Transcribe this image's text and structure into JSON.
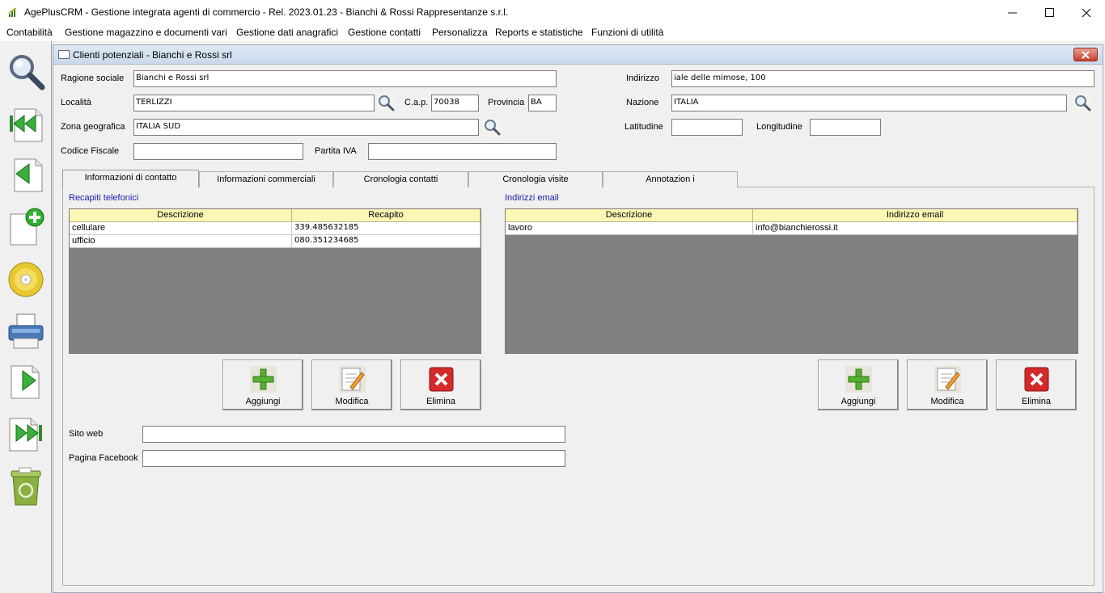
{
  "window": {
    "title": "AgePlusCRM - Gestione integrata agenti di commercio - Rel. 2023.01.23 - Bianchi & Rossi Rappresentanze s.r.l.",
    "minimize_icon": "minimize-icon",
    "maximize_icon": "maximize-icon",
    "close_icon": "close-icon"
  },
  "menu": [
    {
      "label": "Contabilità"
    },
    {
      "label": "Gestione magazzino e documenti vari"
    },
    {
      "label": "Gestione dati anagrafici"
    },
    {
      "label": "Gestione contatti"
    },
    {
      "label": "Personalizza"
    },
    {
      "label": "Reports e statistiche"
    },
    {
      "label": "Funzioni di utilità"
    }
  ],
  "toolbar": [
    {
      "icon": "search-icon"
    },
    {
      "icon": "first-record-icon"
    },
    {
      "icon": "previous-record-icon"
    },
    {
      "icon": "new-record-icon"
    },
    {
      "icon": "save-disc-icon"
    },
    {
      "icon": "printer-icon"
    },
    {
      "icon": "next-record-icon"
    },
    {
      "icon": "last-record-icon"
    },
    {
      "icon": "recycle-bin-icon"
    }
  ],
  "form": {
    "title": "Clienti potenziali - Bianchi e Rossi srl",
    "ragione_sociale": {
      "label": "Ragione sociale",
      "value": "Bianchi e Rossi srl"
    },
    "localita": {
      "label": "Località",
      "value": "TERLIZZI"
    },
    "cap": {
      "label": "C.a.p.",
      "value": "70038"
    },
    "provincia": {
      "label": "Provincia",
      "value": "BA"
    },
    "zona": {
      "label": "Zona geografica",
      "value": "ITALIA SUD"
    },
    "codice_fiscale": {
      "label": "Codice Fiscale",
      "value": ""
    },
    "partita_iva": {
      "label": "Partita IVA",
      "value": ""
    },
    "indirizzo": {
      "label": "Indirizzo",
      "value": "iale delle mimose, 100"
    },
    "nazione": {
      "label": "Nazione",
      "value": "ITALIA"
    },
    "latitudine": {
      "label": "Latitudine",
      "value": ""
    },
    "longitudine": {
      "label": "Longitudine",
      "value": ""
    }
  },
  "tabs": [
    {
      "label": "Informazioni di contatto",
      "active": true
    },
    {
      "label": "Informazioni commerciali"
    },
    {
      "label": "Cronologia contatti"
    },
    {
      "label": "Cronologia visite"
    },
    {
      "label": "Annotazion i"
    }
  ],
  "phones": {
    "title": "Recapiti telefonici",
    "columns": [
      "Descrizione",
      "Recapito"
    ],
    "rows": [
      [
        "cellulare",
        "339.485632185"
      ],
      [
        "ufficio",
        "080.351234685"
      ]
    ]
  },
  "emails": {
    "title": "Indirizzi email",
    "columns": [
      "Descrizione",
      "Indirizzo email"
    ],
    "rows": [
      [
        "lavoro",
        "info@bianchierossi.it"
      ]
    ]
  },
  "buttons": {
    "add": "Aggiungi",
    "edit": "Modifica",
    "delete": "Elimina"
  },
  "web": {
    "sito": {
      "label": "Sito web",
      "value": ""
    },
    "facebook": {
      "label": "Pagina Facebook",
      "value": ""
    }
  },
  "colors": {
    "grid_header": "#fbf7b5",
    "grid_empty": "#808080",
    "section_title": "#1a1aa8"
  }
}
